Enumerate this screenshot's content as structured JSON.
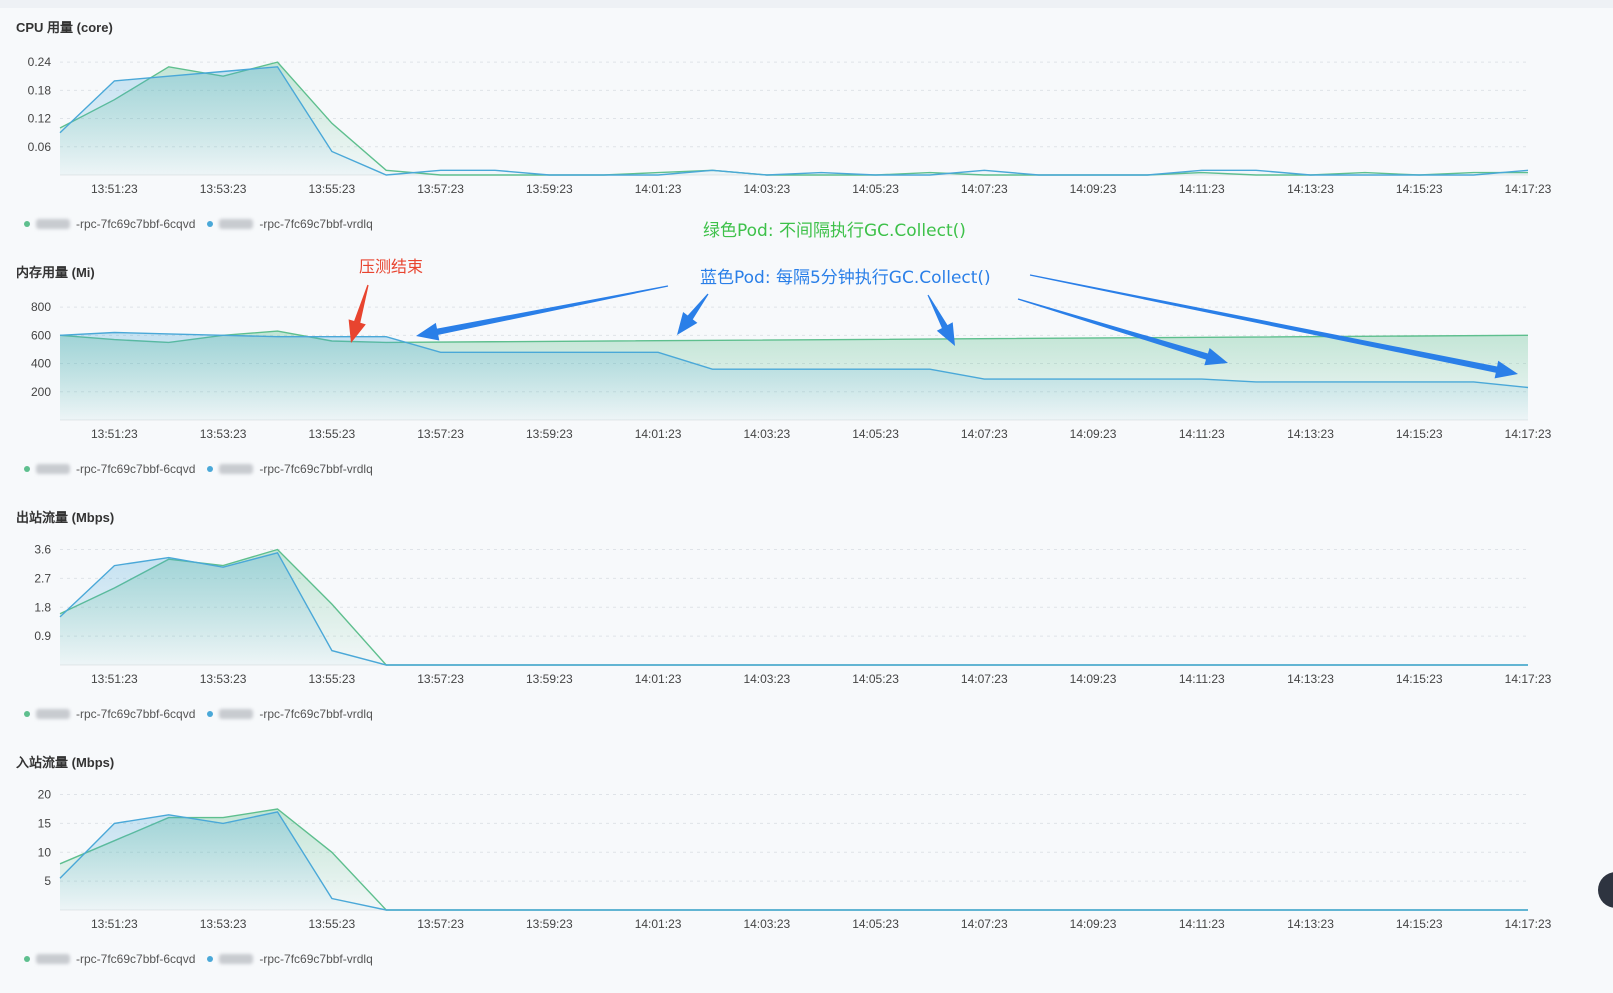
{
  "colors": {
    "green": "#5ebf8e",
    "blue": "#4aa8d8",
    "annotation_green": "#3ec14a",
    "annotation_blue": "#2a7fe8",
    "annotation_red": "#e8442f",
    "arrow_blue": "#2a7fe8",
    "arrow_red": "#e8442f"
  },
  "x_ticks": [
    "13:51:23",
    "13:53:23",
    "13:55:23",
    "13:57:23",
    "13:59:23",
    "14:01:23",
    "14:03:23",
    "14:05:23",
    "14:07:23",
    "14:09:23",
    "14:11:23",
    "14:13:23",
    "14:15:23",
    "14:17:23"
  ],
  "legend": {
    "series_a_suffix": "-rpc-7fc69c7bbf-6cqvd",
    "series_b_suffix": "-rpc-7fc69c7bbf-vrdlq"
  },
  "annotations": {
    "green_pod": "绿色Pod: 不间隔执行GC.Collect()",
    "blue_pod": "蓝色Pod: 每隔5分钟执行GC.Collect()",
    "stress_end": "压测结束"
  },
  "chart_data": [
    {
      "type": "area",
      "title": "CPU 用量 (core)",
      "yticks": [
        "0.24",
        "0.18",
        "0.12",
        "0.06"
      ],
      "ylim": [
        0,
        0.27
      ],
      "x_start": "13:50:23",
      "x_end": "14:17:23",
      "grid": true,
      "series": [
        {
          "name": "-rpc-7fc69c7bbf-6cqvd",
          "color": "green",
          "x": [
            "13:50:23",
            "13:51:23",
            "13:52:23",
            "13:53:23",
            "13:54:23",
            "13:55:23",
            "13:56:23",
            "13:57:23",
            "13:58:23",
            "13:59:23",
            "14:00:23",
            "14:01:23",
            "14:02:23",
            "14:03:23",
            "14:04:23",
            "14:05:23",
            "14:06:23",
            "14:07:23",
            "14:08:23",
            "14:09:23",
            "14:10:23",
            "14:11:23",
            "14:12:23",
            "14:13:23",
            "14:14:23",
            "14:15:23",
            "14:16:23",
            "14:17:23"
          ],
          "values": [
            0.1,
            0.16,
            0.23,
            0.21,
            0.24,
            0.11,
            0.01,
            0.0,
            0.0,
            0.0,
            0.0,
            0.005,
            0.01,
            0.0,
            0.0,
            0.0,
            0.005,
            0.0,
            0.0,
            0.0,
            0.0,
            0.005,
            0.0,
            0.0,
            0.005,
            0.0,
            0.005,
            0.005
          ]
        },
        {
          "name": "-rpc-7fc69c7bbf-vrdlq",
          "color": "blue",
          "x": [
            "13:50:23",
            "13:51:23",
            "13:52:23",
            "13:53:23",
            "13:54:23",
            "13:55:23",
            "13:56:23",
            "13:57:23",
            "13:58:23",
            "13:59:23",
            "14:00:23",
            "14:01:23",
            "14:02:23",
            "14:03:23",
            "14:04:23",
            "14:05:23",
            "14:06:23",
            "14:07:23",
            "14:08:23",
            "14:09:23",
            "14:10:23",
            "14:11:23",
            "14:12:23",
            "14:13:23",
            "14:14:23",
            "14:15:23",
            "14:16:23",
            "14:17:23"
          ],
          "values": [
            0.09,
            0.2,
            0.21,
            0.22,
            0.23,
            0.05,
            0.0,
            0.01,
            0.01,
            0.0,
            0.0,
            0.0,
            0.01,
            0.0,
            0.005,
            0.0,
            0.0,
            0.01,
            0.0,
            0.0,
            0.0,
            0.01,
            0.01,
            0.0,
            0.0,
            0.0,
            0.0,
            0.01
          ]
        }
      ]
    },
    {
      "type": "area",
      "title": "内存用量 (Mi)",
      "yticks": [
        "800",
        "600",
        "400",
        "200"
      ],
      "ylim": [
        0,
        900
      ],
      "x_start": "13:50:23",
      "x_end": "14:17:23",
      "grid": true,
      "series": [
        {
          "name": "-rpc-7fc69c7bbf-6cqvd",
          "color": "green",
          "x": [
            "13:50:23",
            "13:51:23",
            "13:52:23",
            "13:53:23",
            "13:54:23",
            "13:55:23",
            "13:56:23",
            "14:17:23"
          ],
          "values": [
            600,
            570,
            550,
            600,
            630,
            560,
            550,
            600
          ]
        },
        {
          "name": "-rpc-7fc69c7bbf-vrdlq",
          "color": "blue",
          "x": [
            "13:50:23",
            "13:51:23",
            "13:52:23",
            "13:53:23",
            "13:54:23",
            "13:55:23",
            "13:56:23",
            "13:57:23",
            "14:01:23",
            "14:02:23",
            "14:06:23",
            "14:07:23",
            "14:11:23",
            "14:12:23",
            "14:16:23",
            "14:17:23"
          ],
          "values": [
            600,
            620,
            610,
            600,
            590,
            590,
            590,
            480,
            480,
            360,
            360,
            290,
            290,
            270,
            270,
            230
          ]
        }
      ]
    },
    {
      "type": "area",
      "title": "出站流量 (Mbps)",
      "yticks": [
        "3.6",
        "2.7",
        "1.8",
        "0.9"
      ],
      "ylim": [
        0,
        3.96
      ],
      "x_start": "13:50:23",
      "x_end": "14:17:23",
      "grid": true,
      "series": [
        {
          "name": "-rpc-7fc69c7bbf-6cqvd",
          "color": "green",
          "x": [
            "13:50:23",
            "13:51:23",
            "13:52:23",
            "13:53:23",
            "13:54:23",
            "13:55:23",
            "13:56:23",
            "14:17:23"
          ],
          "values": [
            1.6,
            2.4,
            3.3,
            3.1,
            3.6,
            1.9,
            0.0,
            0.0
          ]
        },
        {
          "name": "-rpc-7fc69c7bbf-vrdlq",
          "color": "blue",
          "x": [
            "13:50:23",
            "13:51:23",
            "13:52:23",
            "13:53:23",
            "13:54:23",
            "13:55:23",
            "13:56:23",
            "14:17:23"
          ],
          "values": [
            1.5,
            3.1,
            3.35,
            3.05,
            3.5,
            0.45,
            0.0,
            0.0
          ]
        }
      ]
    },
    {
      "type": "area",
      "title": "入站流量 (Mbps)",
      "yticks": [
        "20",
        "15",
        "10",
        "5"
      ],
      "ylim": [
        0,
        22
      ],
      "x_start": "13:50:23",
      "x_end": "14:17:23",
      "grid": true,
      "series": [
        {
          "name": "-rpc-7fc69c7bbf-6cqvd",
          "color": "green",
          "x": [
            "13:50:23",
            "13:51:23",
            "13:52:23",
            "13:53:23",
            "13:54:23",
            "13:55:23",
            "13:56:23",
            "14:17:23"
          ],
          "values": [
            8,
            12,
            16,
            16,
            17.5,
            10,
            0.0,
            0.0
          ]
        },
        {
          "name": "-rpc-7fc69c7bbf-vrdlq",
          "color": "blue",
          "x": [
            "13:50:23",
            "13:51:23",
            "13:52:23",
            "13:53:23",
            "13:54:23",
            "13:55:23",
            "13:56:23",
            "14:17:23"
          ],
          "values": [
            5.5,
            15,
            16.5,
            15,
            17,
            2,
            0.0,
            0.0
          ]
        }
      ]
    }
  ]
}
